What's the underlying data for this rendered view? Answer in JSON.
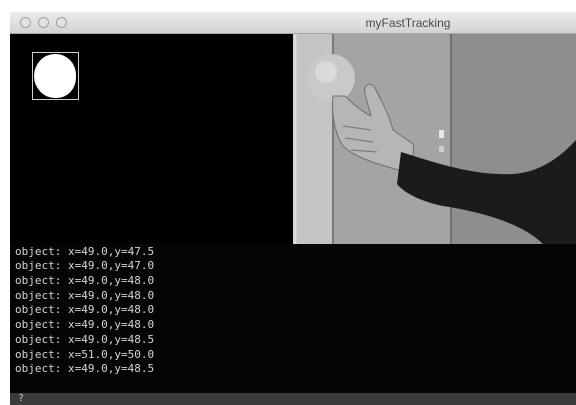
{
  "window": {
    "title": "myFastTracking"
  },
  "terminal": {
    "lines": [
      "object: x=49.0,y=47.5",
      "object: x=49.0,y=47.0",
      "object: x=49.0,y=48.0",
      "object: x=49.0,y=48.0",
      "object: x=49.0,y=48.0",
      "object: x=49.0,y=48.0",
      "object: x=49.0,y=48.5",
      "object: x=51.0,y=50.0",
      "object: x=49.0,y=48.5"
    ],
    "prompt": "?"
  },
  "colors": {
    "window_bg": "#000000",
    "blob": "#ffffff",
    "terminal_text": "#d4d4d4"
  },
  "icons": [
    "close-icon",
    "minimize-icon",
    "zoom-icon"
  ]
}
